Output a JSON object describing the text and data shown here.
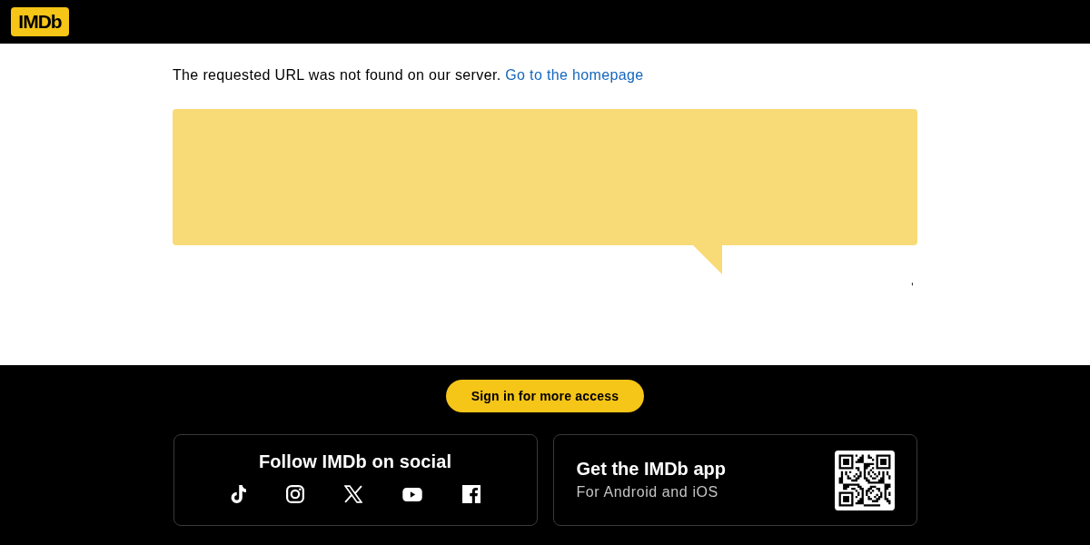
{
  "header": {
    "logo": "IMDb"
  },
  "message": {
    "text": "The requested URL was not found on our server.",
    "link": "Go to the homepage"
  },
  "mark_below_bubble": ",",
  "footer": {
    "sign_in_button": "Sign in for more access",
    "social": {
      "title": "Follow IMDb on social"
    },
    "app": {
      "title": "Get the IMDb app",
      "subtitle": "For Android and iOS"
    }
  }
}
